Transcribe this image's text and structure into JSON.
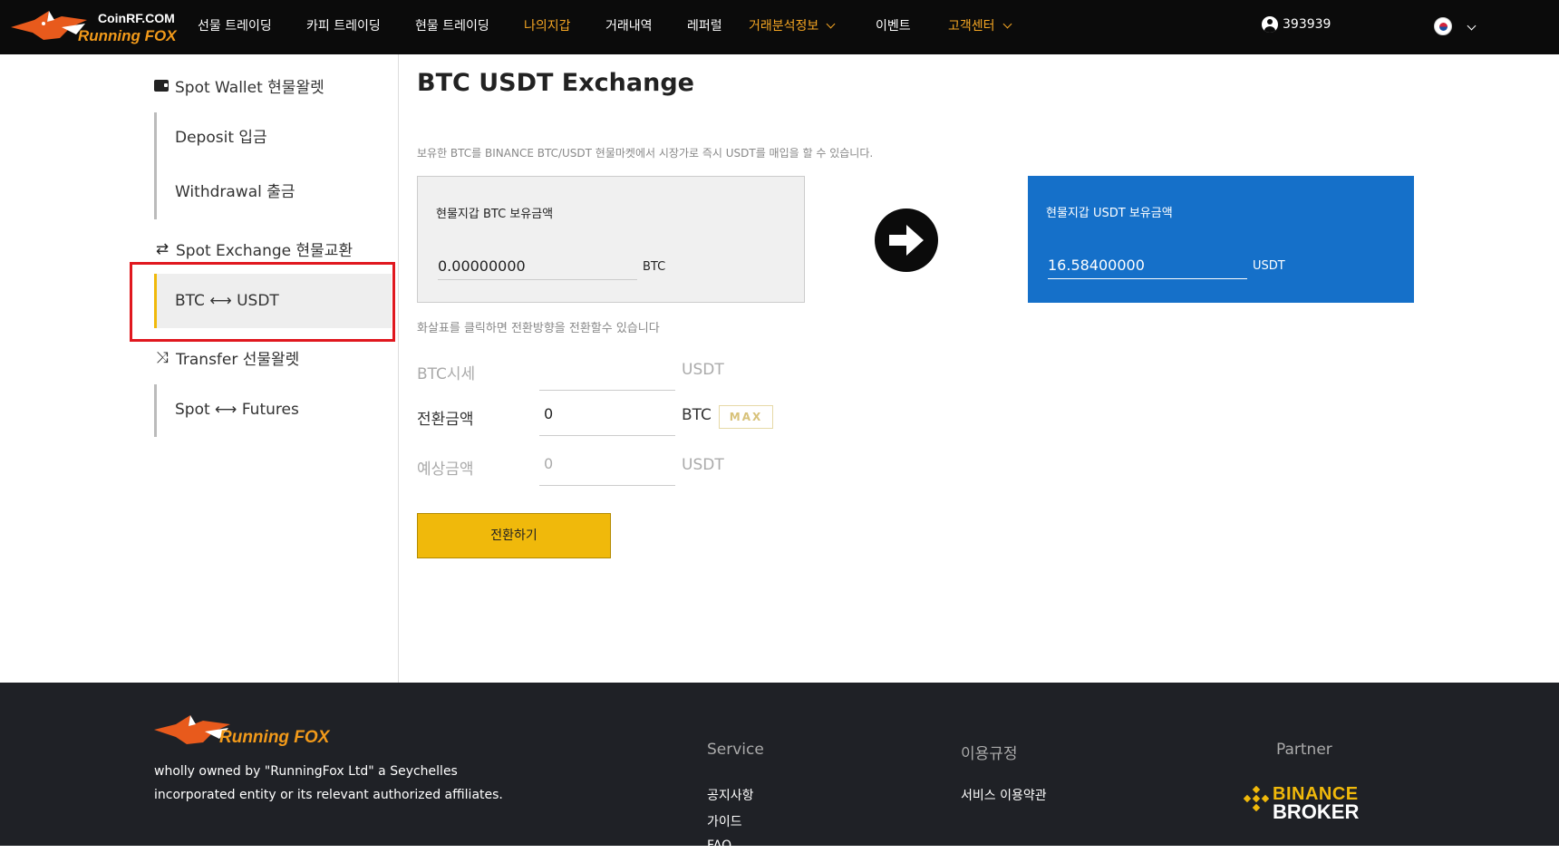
{
  "nav": {
    "logo_brand": "CoinRF.COM",
    "logo_text": "Running FOX",
    "items": [
      {
        "label": "선물 트레이딩"
      },
      {
        "label": "카피 트레이딩"
      },
      {
        "label": "현물 트레이딩"
      },
      {
        "label": "나의지갑"
      },
      {
        "label": "거래내역"
      },
      {
        "label": "레퍼럴"
      },
      {
        "label": "거래분석정보"
      },
      {
        "label": "이벤트"
      },
      {
        "label": "고객센터"
      }
    ],
    "user_id": "393939",
    "active_color": "#f5a623"
  },
  "sidebar": {
    "spot_wallet": "Spot Wallet 현물왈렛",
    "deposit": "Deposit 입금",
    "withdrawal": "Withdrawal 출금",
    "spot_exchange": "Spot Exchange 현물교환",
    "btc_usdt": "BTC ⟷ USDT",
    "transfer": "Transfer 선물왈렛",
    "spot_futures": "Spot ⟷ Futures"
  },
  "main": {
    "title": "BTC USDT Exchange",
    "description": "보유한 BTC를 BINANCE BTC/USDT 현물마켓에서 시장가로 즉시 USDT를 매입을 할 수 있습니다.",
    "btc_card": {
      "label": "현물지갑 BTC 보유금액",
      "value": "0.00000000",
      "unit": "BTC"
    },
    "usdt_card": {
      "label": "현물지갑 USDT 보유금액",
      "value": "16.58400000",
      "unit": "USDT"
    },
    "hint": "화살표를 클릭하면 전환방향을 전환할수 있습니다",
    "form": {
      "price_label": "BTC시세",
      "price_value": "",
      "price_unit": "USDT",
      "amount_label": "전환금액",
      "amount_value": "0",
      "amount_unit": "BTC",
      "max_label": "MAX",
      "expected_label": "예상금액",
      "expected_value": "0",
      "expected_unit": "USDT"
    },
    "convert_button": "전환하기"
  },
  "footer": {
    "logo_text": "Running FOX",
    "description": "wholly owned by \"RunningFox Ltd\" a Seychelles incorporated entity or its relevant authorized affiliates.",
    "service_head": "Service",
    "service_links": [
      "공지사항",
      "가이드",
      "FAQ"
    ],
    "terms_head": "이용규정",
    "terms_links": [
      "서비스 이용약관"
    ],
    "partner_head": "Partner",
    "partner_binance": "BINANCE",
    "partner_broker": "BROKER"
  },
  "colors": {
    "accent": "#f0b90b",
    "usdt_card": "#1570c9",
    "highlight": "#e0181f"
  }
}
